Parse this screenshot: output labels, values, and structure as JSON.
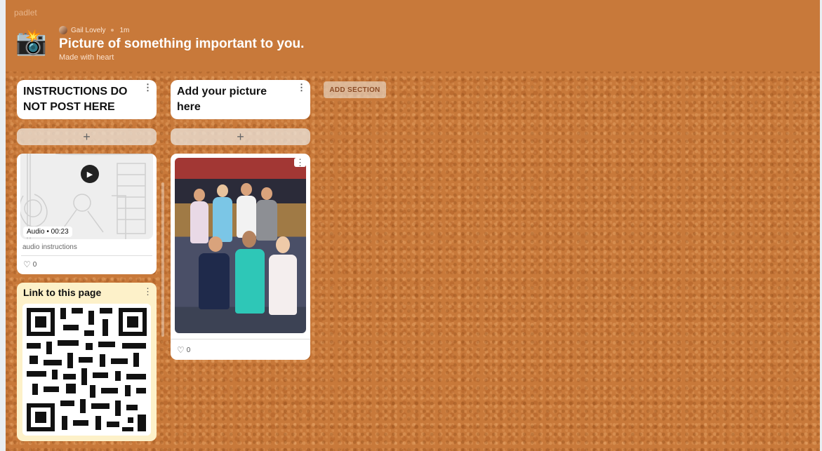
{
  "header": {
    "brand": "padlet",
    "author": "Gail Lovely",
    "time": "1m",
    "title": "Picture of something important to you.",
    "subtitle": "Made with heart",
    "icon": "camera-icon"
  },
  "sections": [
    {
      "title": "INSTRUCTIONS DO NOT POST HERE",
      "add_label": "+",
      "cards": [
        {
          "type": "audio",
          "tag": "Audio",
          "duration": "00:23",
          "caption": "audio instructions",
          "likes": "0"
        },
        {
          "type": "link",
          "title": "Link to this page"
        }
      ]
    },
    {
      "title": "Add your picture here",
      "add_label": "+",
      "cards": [
        {
          "type": "photo",
          "likes": "0"
        }
      ]
    }
  ],
  "add_section_label": "ADD SECTION",
  "colors": {
    "background": "#c8793a",
    "card": "#ffffff",
    "link_card": "#fdf1c9"
  }
}
